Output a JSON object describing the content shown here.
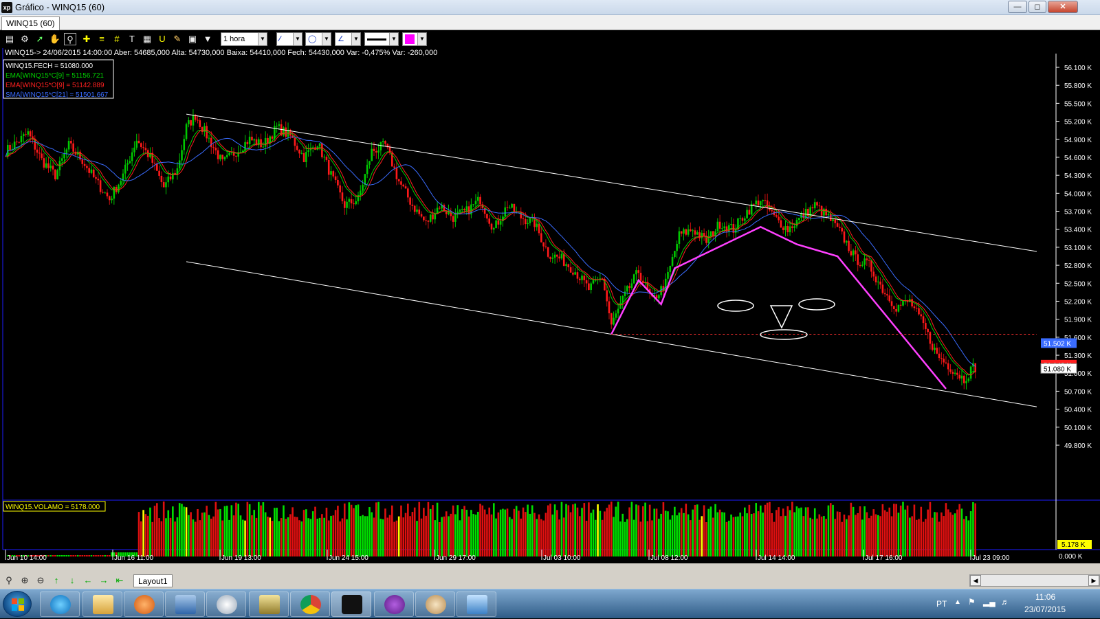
{
  "window": {
    "title": "Gráfico - WINQ15 (60)",
    "app_icon": "xp",
    "controls": [
      "minimize",
      "maximize",
      "close"
    ]
  },
  "doc_tab": "WINQ15 (60)",
  "toolbar": {
    "timeframe": "1 hora",
    "color_swatch": "#ff00ff",
    "icons": [
      "bar-chart-icon",
      "gear-icon",
      "indicator-icon",
      "hand-icon",
      "zoom-box-icon",
      "crosshair-icon",
      "grid-icon",
      "text-icon",
      "calculator-icon",
      "magnet-icon",
      "pencil-icon",
      "lock-icon",
      "filter-icon"
    ]
  },
  "info_line": "WINQ15-> 24/06/2015 14:00:00 Aber: 54685,000 Alta: 54730,000 Baixa: 54410,000 Fech: 54430,000 Var: -0,475% Var: -260,000",
  "legend": [
    {
      "text": "WINQ15.FECH = 51080.000",
      "color": "#ffffff"
    },
    {
      "text": "EMA[WINQ15*C[9] = 51156.721",
      "color": "#00d000"
    },
    {
      "text": "EMA[WINQ15*O[9] = 51142.889",
      "color": "#ff2020"
    },
    {
      "text": "SMA[WINQ15*C[21] = 51501.667",
      "color": "#3a6cff"
    }
  ],
  "volume_label": "WINQ15.VOLAMO = 5178.000",
  "chart_data": {
    "type": "candlestick",
    "symbol": "WINQ15",
    "interval": "1 hora",
    "ylim": [
      49800,
      56100
    ],
    "price_ticks": [
      "56.100 K",
      "55.800 K",
      "55.500 K",
      "55.200 K",
      "54.900 K",
      "54.600 K",
      "54.300 K",
      "54.000 K",
      "53.700 K",
      "53.400 K",
      "53.100 K",
      "52.800 K",
      "52.500 K",
      "52.200 K",
      "51.900 K",
      "51.600 K",
      "51.300 K",
      "51.000 K",
      "50.700 K",
      "50.400 K",
      "50.100 K",
      "49.800 K"
    ],
    "price_tick_values": [
      56100,
      55800,
      55500,
      55200,
      54900,
      54600,
      54300,
      54000,
      53700,
      53400,
      53100,
      52800,
      52500,
      52200,
      51900,
      51600,
      51300,
      51000,
      50700,
      50400,
      50100,
      49800
    ],
    "markers": [
      {
        "label": "51.502 K",
        "value": 51502,
        "color": "#3a6cff"
      },
      {
        "label": "51.142 K",
        "value": 51142,
        "color": "#ff2020"
      },
      {
        "label": "51.080 K",
        "value": 51080,
        "color": "#ffffff"
      }
    ],
    "volume_ticks": [
      "5.178 K",
      "0.000 K"
    ],
    "date_labels": [
      "Jun 10 14:00",
      "Jun 16 11:00",
      "Jun 19 13:00",
      "Jun 24 15:00",
      "Jun 29 17:00",
      "Jul 03 10:00",
      "Jul 08 12:00",
      "Jul 14 14:00",
      "Jul 17 16:00",
      "Jul 23 09:00"
    ],
    "price_path": [
      [
        0,
        54700
      ],
      [
        10,
        55000
      ],
      [
        16,
        54550
      ],
      [
        22,
        54300
      ],
      [
        28,
        54800
      ],
      [
        34,
        54550
      ],
      [
        40,
        54200
      ],
      [
        46,
        53900
      ],
      [
        52,
        54300
      ],
      [
        58,
        54900
      ],
      [
        64,
        54600
      ],
      [
        70,
        54100
      ],
      [
        76,
        54400
      ],
      [
        80,
        55100
      ],
      [
        84,
        55300
      ],
      [
        90,
        54900
      ],
      [
        96,
        54500
      ],
      [
        102,
        54700
      ],
      [
        108,
        54900
      ],
      [
        114,
        54800
      ],
      [
        120,
        55100
      ],
      [
        126,
        54950
      ],
      [
        132,
        54600
      ],
      [
        138,
        54850
      ],
      [
        144,
        54300
      ],
      [
        150,
        53800
      ],
      [
        156,
        53900
      ],
      [
        162,
        54700
      ],
      [
        168,
        54800
      ],
      [
        174,
        54200
      ],
      [
        180,
        53800
      ],
      [
        186,
        53500
      ],
      [
        192,
        53800
      ],
      [
        198,
        53600
      ],
      [
        204,
        53700
      ],
      [
        210,
        53900
      ],
      [
        216,
        53400
      ],
      [
        222,
        53800
      ],
      [
        228,
        53600
      ],
      [
        234,
        53500
      ],
      [
        240,
        53000
      ],
      [
        246,
        52900
      ],
      [
        252,
        52700
      ],
      [
        258,
        52400
      ],
      [
        264,
        52600
      ],
      [
        268,
        51800
      ],
      [
        274,
        52300
      ],
      [
        280,
        52700
      ],
      [
        286,
        52200
      ],
      [
        292,
        52500
      ],
      [
        298,
        53300
      ],
      [
        304,
        53400
      ],
      [
        310,
        53200
      ],
      [
        316,
        53500
      ],
      [
        322,
        53400
      ],
      [
        328,
        53700
      ],
      [
        334,
        53900
      ],
      [
        340,
        53600
      ],
      [
        346,
        53400
      ],
      [
        352,
        53600
      ],
      [
        358,
        53800
      ],
      [
        364,
        53600
      ],
      [
        370,
        53300
      ],
      [
        376,
        52900
      ],
      [
        382,
        52800
      ],
      [
        388,
        52400
      ],
      [
        394,
        52100
      ],
      [
        400,
        52200
      ],
      [
        406,
        51800
      ],
      [
        412,
        51300
      ],
      [
        418,
        51100
      ],
      [
        424,
        50900
      ],
      [
        428,
        51100
      ]
    ],
    "overlay_lines": [
      {
        "name": "channel-top",
        "color": "#ffffff",
        "from": [
          80,
          55320
        ],
        "to": [
          485,
          53030
        ]
      },
      {
        "name": "channel-bottom",
        "color": "#ffffff",
        "from": [
          80,
          52860
        ],
        "to": [
          485,
          50440
        ]
      },
      {
        "name": "zigzag",
        "color": "#ff40ff",
        "points": [
          [
            268,
            51650
          ],
          [
            280,
            52550
          ],
          [
            290,
            52150
          ],
          [
            296,
            52750
          ],
          [
            334,
            53440
          ],
          [
            350,
            53150
          ],
          [
            368,
            52950
          ],
          [
            416,
            50740
          ]
        ]
      },
      {
        "name": "support-dotted",
        "color": "#ff3030",
        "from": [
          268,
          51650
        ],
        "to": [
          485,
          51650
        ]
      }
    ]
  }
}
